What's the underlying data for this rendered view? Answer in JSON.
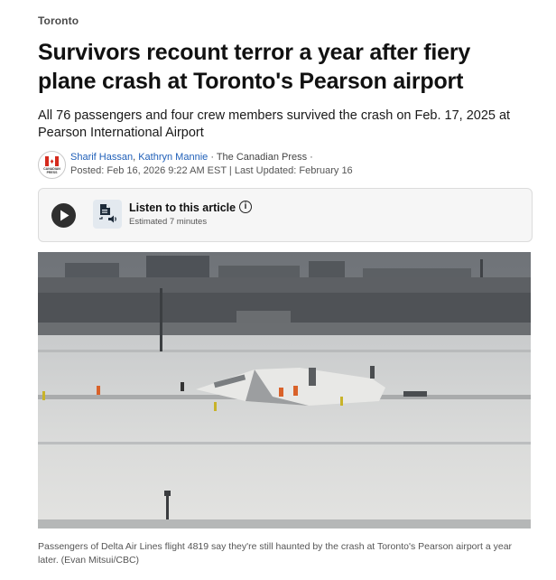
{
  "article": {
    "section": "Toronto",
    "headline": "Survivors recount terror a year after fiery plane crash at Toronto's Pearson airport",
    "dek": "All 76 passengers and four crew members survived the crash on Feb. 17, 2025 at Pearson International Airport",
    "byline": {
      "logo_text": "CANADIAN PRESS",
      "author_1": "Sharif Hassan",
      "separator": ", ",
      "author_2": "Kathryn Mannie",
      "source": " · The Canadian Press ·",
      "posted": "Posted: Feb 16, 2026 9:22 AM EST | Last Updated: February 16"
    },
    "listen": {
      "title": "Listen to this article",
      "estimate": "Estimated 7 minutes",
      "info_glyph": "i",
      "icons": [
        "play-icon",
        "audio-document-icon",
        "info-icon"
      ]
    },
    "photo": {
      "alt": "Overturned plane on a snowy runway at Pearson airport"
    },
    "caption": "Passengers of Delta Air Lines flight 4819 say they're still haunted by the crash at Toronto's Pearson airport a year later. (Evan Mitsui/CBC)"
  },
  "colors": {
    "link": "#1f5fb8",
    "logo_red": "#d52b1e",
    "listen_bg": "#f6f6f6",
    "play_button": "#2f2f2f"
  }
}
